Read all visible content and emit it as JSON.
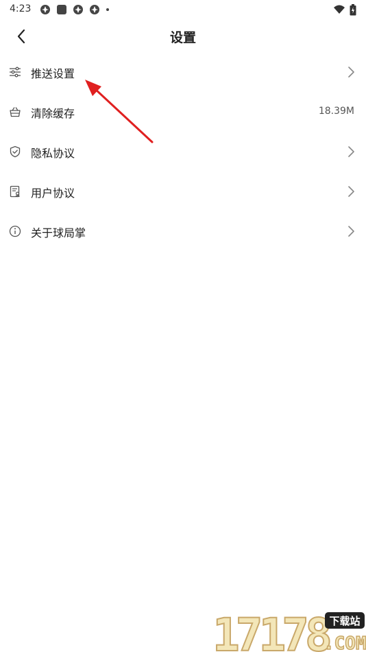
{
  "status_bar": {
    "time": "4:23",
    "icons_left": [
      "circle-status-icon",
      "square-app-icon",
      "circle-status-icon",
      "circle-status-icon",
      "dot-icon"
    ],
    "icons_right": [
      "wifi-icon",
      "battery-icon"
    ]
  },
  "header": {
    "title": "设置",
    "back_icon": "chevron-left-icon"
  },
  "menu": {
    "items": [
      {
        "label": "推送设置",
        "icon": "sliders-icon",
        "value": "",
        "chevron": true
      },
      {
        "label": "清除缓存",
        "icon": "basket-icon",
        "value": "18.39M",
        "chevron": false
      },
      {
        "label": "隐私协议",
        "icon": "shield-check-icon",
        "value": "",
        "chevron": true
      },
      {
        "label": "用户协议",
        "icon": "document-user-icon",
        "value": "",
        "chevron": true
      },
      {
        "label": "关于球局掌",
        "icon": "info-icon",
        "value": "",
        "chevron": true
      }
    ]
  },
  "annotation": {
    "arrow_color": "#e02020",
    "points_to": "推送设置"
  },
  "watermark": {
    "text_big": "17178",
    "text_tag": "下载站",
    "text_small": ".COM",
    "colors": {
      "fill": "#f3e6b8",
      "outline": "#c9a86a",
      "tag_bg": "#222222"
    }
  }
}
